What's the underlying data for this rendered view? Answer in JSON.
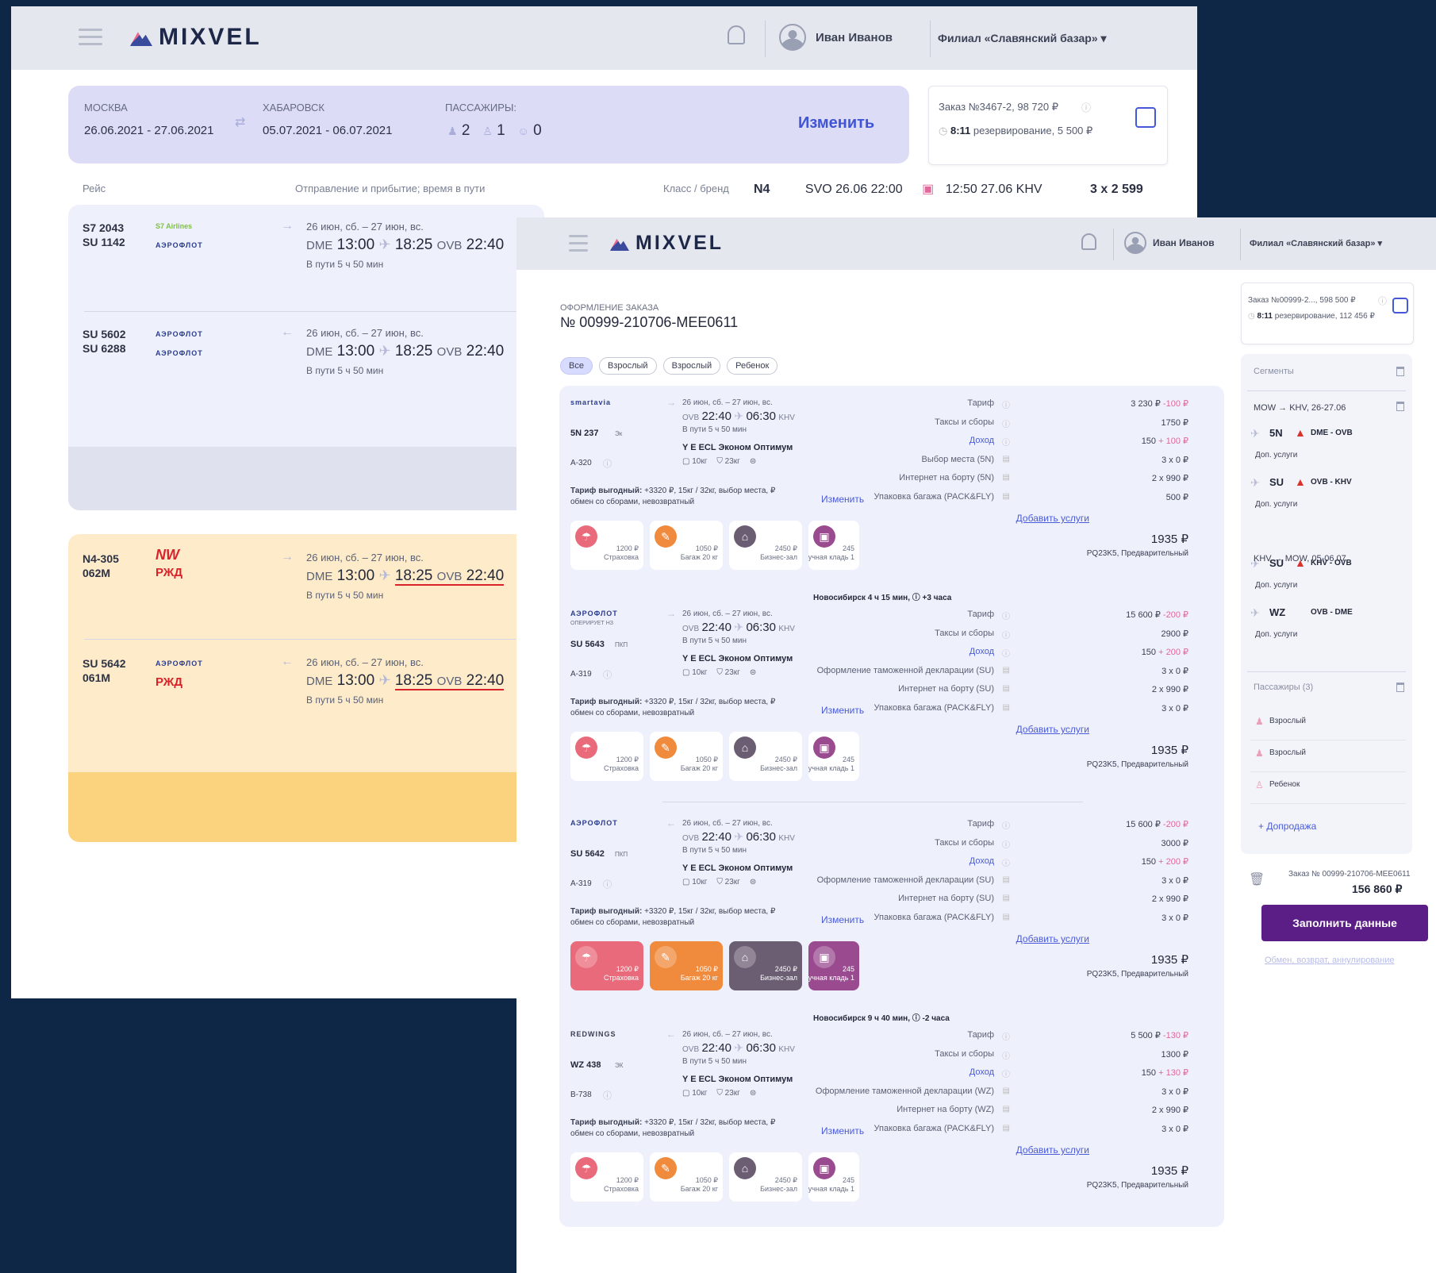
{
  "back": {
    "brand": "MIXVEL",
    "user": "Иван Иванов",
    "branch": "Филиал «Славянский базар» ▾",
    "search": {
      "from_label": "МОСКВА",
      "from_dates": "26.06.2021 - 27.06.2021",
      "to_label": "ХАБАРОВСК",
      "to_dates": "05.07.2021 - 06.07.2021",
      "pax_label": "ПАССАЖИРЫ:",
      "pax_adults": "2",
      "pax_kids": "1",
      "pax_infants": "0",
      "change": "Изменить"
    },
    "order": {
      "title": "Заказ №3467-2, 98 720 ₽",
      "timer": "8:11",
      "status": "резервирование, 5 500 ₽"
    },
    "table_headers": {
      "flight": "Рейс",
      "route": "Отправление и прибытие; время в пути",
      "class": "Класс / бренд"
    },
    "fare_class": {
      "code": "N4",
      "dep": "SVO 26.06 22:00",
      "arr": "12:50 27.06 KHV",
      "price": "3 х 2 599"
    },
    "rows": [
      {
        "fno": "S7 2043\nSU 1142",
        "a1": "S7 Airlines",
        "a2": "АЭРОФЛОТ",
        "dir": "→",
        "dates": "26 июн, сб. – 27 июн, вс.",
        "dep_code": "DME",
        "dep": "13:00",
        "arr": "18:25",
        "arr_code": "OVB",
        "arr2": "22:40",
        "dur": "В пути 5 ч 50 мин"
      },
      {
        "fno": "SU 5602\nSU 6288",
        "a1": "АЭРОФЛОТ",
        "a2": "АЭРОФЛОТ",
        "dir": "←",
        "dates": "26 июн, сб. – 27 июн, вс.",
        "dep_code": "DME",
        "dep": "13:00",
        "arr": "18:25",
        "arr_code": "OVB",
        "arr2": "22:40",
        "dur": "В пути 5 ч 50 мин"
      },
      {
        "fno": "N4-305\n062М",
        "a1": "NW",
        "a2": "РЖД",
        "dir": "→",
        "dates": "26 июн, сб. – 27 июн, вс.",
        "dep_code": "DME",
        "dep": "13:00",
        "arr": "18:25",
        "arr_code": "OVB",
        "arr2": "22:40",
        "dur": "В пути 5 ч 50 мин"
      },
      {
        "fno": "SU 5642\n061М",
        "a1": "АЭРОФЛОТ",
        "a2": "РЖД",
        "dir": "←",
        "dates": "26 июн, сб. – 27 июн, вс.",
        "dep_code": "DME",
        "dep": "13:00",
        "arr": "18:25",
        "arr_code": "OVB",
        "arr2": "22:40",
        "dur": "В пути 5 ч 50 мин"
      }
    ]
  },
  "front": {
    "brand": "MIXVEL",
    "user": "Иван Иванов",
    "branch": "Филиал «Славянский базар» ▾",
    "title_small": "ОФОРМЛЕНИЕ ЗАКАЗА",
    "order_number": "№ 00999-210706-MEE0611",
    "filters": [
      "Все",
      "Взрослый",
      "Взрослый",
      "Ребенок"
    ],
    "tariff_note_bold": "Тариф выгодный:",
    "tariff_note": "+3320 ₽, 15кг / 32кг, выбор места, ₽ обмен со сборами, невозвратный",
    "change": "Изменить",
    "add_services": "Добавить услуги",
    "total": "1935 ₽",
    "fare": "PQ23K5, Предварительный",
    "services": [
      {
        "icon": "umbrella-icon",
        "price": "1200 ₽",
        "name": "Страховка",
        "color": "#e96a7a"
      },
      {
        "icon": "luggage-icon",
        "price": "1050 ₽",
        "name": "Багаж 20 кг",
        "color": "#f08a3c"
      },
      {
        "icon": "lounge-icon",
        "price": "2450 ₽",
        "name": "Бизнес-зал",
        "color": "#6b5e73"
      },
      {
        "icon": "bag-icon",
        "price": "245",
        "name": "Ручная кладь 1",
        "color": "#9a4b8f"
      }
    ],
    "segments": [
      {
        "airline": "smartavia",
        "fno": "5N 237",
        "cls": "Эк",
        "aircraft": "A-320",
        "dir": "→",
        "dates": "26 июн, сб. – 27 июн, вс.",
        "dep_code": "OVB",
        "dep": "22:40",
        "arr": "06:30",
        "arr_code": "KHV",
        "dur": "В пути 5 ч 50 мин",
        "brand": "Y E ECL Эконом Оптимум",
        "bag1": "10кг",
        "bag2": "23кг",
        "lines": [
          {
            "l": "Тариф",
            "v": "3 230 ₽",
            "p": "-100 ₽"
          },
          {
            "l": "Таксы и сборы",
            "v": "1750 ₽",
            "p": ""
          },
          {
            "l": "Доход",
            "v": "150",
            "p": "+ 100 ₽",
            "blue": true
          },
          {
            "l": "Выбор места (5N)",
            "v": "3 х 0 ₽",
            "p": ""
          },
          {
            "l": "Интернет на борту (5N)",
            "v": "2 х 990 ₽",
            "p": ""
          },
          {
            "l": "Упаковка багажа (PACK&FLY)",
            "v": "500 ₽",
            "p": ""
          }
        ]
      },
      {
        "airline": "АЭРОФЛОТ",
        "op": "ОПЕРИРУЕТ НЗ",
        "fno": "SU 5643",
        "cls": "ПКП",
        "aircraft": "A-319",
        "dir": "→",
        "dates": "26 июн, сб. – 27 июн, вс.",
        "dep_code": "OVB",
        "dep": "22:40",
        "arr": "06:30",
        "arr_code": "KHV",
        "dur": "В пути 5 ч 50 мин",
        "brand": "Y E ECL Эконом Оптимум",
        "bag1": "10кг",
        "bag2": "23кг",
        "lines": [
          {
            "l": "Тариф",
            "v": "15 600 ₽",
            "p": "-200 ₽"
          },
          {
            "l": "Таксы и сборы",
            "v": "2900 ₽",
            "p": ""
          },
          {
            "l": "Доход",
            "v": "150",
            "p": "+ 200 ₽",
            "blue": true
          },
          {
            "l": "Оформление таможенной декларации (SU)",
            "v": "3 х 0 ₽",
            "p": ""
          },
          {
            "l": "Интернет на борту (SU)",
            "v": "2 х 990 ₽",
            "p": ""
          },
          {
            "l": "Упаковка багажа (PACK&FLY)",
            "v": "3 х 0 ₽",
            "p": ""
          }
        ]
      },
      {
        "airline": "АЭРОФЛОТ",
        "op": "",
        "fno": "SU 5642",
        "cls": "ПКП",
        "aircraft": "A-319",
        "dir": "←",
        "dates": "26 июн, сб. – 27 июн, вс.",
        "dep_code": "OVB",
        "dep": "22:40",
        "arr": "06:30",
        "arr_code": "KHV",
        "dur": "В пути 5 ч 50 мин",
        "brand": "Y E ECL Эконом Оптимум",
        "bag1": "10кг",
        "bag2": "23кг",
        "lines": [
          {
            "l": "Тариф",
            "v": "15 600 ₽",
            "p": "-200 ₽"
          },
          {
            "l": "Таксы и сборы",
            "v": "3000 ₽",
            "p": ""
          },
          {
            "l": "Доход",
            "v": "150",
            "p": "+ 200 ₽",
            "blue": true
          },
          {
            "l": "Оформление таможенной декларации (SU)",
            "v": "3 х 0 ₽",
            "p": ""
          },
          {
            "l": "Интернет на борту (SU)",
            "v": "2 х 990 ₽",
            "p": ""
          },
          {
            "l": "Упаковка багажа (PACK&FLY)",
            "v": "3 х 0 ₽",
            "p": ""
          }
        ]
      },
      {
        "airline": "REDWINGS",
        "op": "",
        "fno": "WZ 438",
        "cls": "ЭК",
        "aircraft": "B-738",
        "dir": "←",
        "dates": "26 июн, сб. – 27 июн, вс.",
        "dep_code": "OVB",
        "dep": "22:40",
        "arr": "06:30",
        "arr_code": "KHV",
        "dur": "В пути 5 ч 50 мин",
        "brand": "Y E ECL Эконом Оптимум",
        "bag1": "10кг",
        "bag2": "23кг",
        "lines": [
          {
            "l": "Тариф",
            "v": "5 500 ₽",
            "p": "-130 ₽"
          },
          {
            "l": "Таксы и сборы",
            "v": "1300 ₽",
            "p": ""
          },
          {
            "l": "Доход",
            "v": "150",
            "p": "+ 130 ₽",
            "blue": true
          },
          {
            "l": "Оформление таможенной декларации (WZ)",
            "v": "3 х 0 ₽",
            "p": ""
          },
          {
            "l": "Интернет на борту (WZ)",
            "v": "2 х 990 ₽",
            "p": ""
          },
          {
            "l": "Упаковка багажа (PACK&FLY)",
            "v": "3 х 0 ₽",
            "p": ""
          }
        ]
      }
    ],
    "transfers": [
      "Новосибирск 4 ч 15 мин, ⓘ +3 часа",
      "Новосибирск 9 ч 40 мин, ⓘ -2 часа"
    ],
    "sidebar": {
      "order_title": "Заказ №00999-2..., 598 500 ₽",
      "timer": "8:11",
      "status": "резервирование, 112 456 ₽",
      "segments_label": "Сегменты",
      "route1": "MOW → KHV, 26-27.06",
      "route2": "KHV → MOW, 05-06.07",
      "legs": [
        {
          "fno": "5N",
          "route": "DME - OVB",
          "extra": "Доп. услуги",
          "warn": true
        },
        {
          "fno": "SU",
          "route": "OVB - KHV",
          "extra": "Доп. услуги",
          "warn": true
        },
        {
          "fno": "SU",
          "route": "KHV - OVB",
          "extra": "Доп. услуги",
          "warn": true
        },
        {
          "fno": "WZ",
          "route": "OVB - DME",
          "extra": "Доп. услуги",
          "warn": false
        }
      ],
      "pax_label": "Пассажиры (3)",
      "pax": [
        "Взрослый",
        "Взрослый",
        "Ребенок"
      ],
      "add_sale": "+ Допродажа",
      "order_full": "Заказ № 00999-210706-MEE0611",
      "sum": "156 860 ₽",
      "fill_btn": "Заполнить данные",
      "exchange": "Обмен, возврат, аннулирование"
    }
  }
}
